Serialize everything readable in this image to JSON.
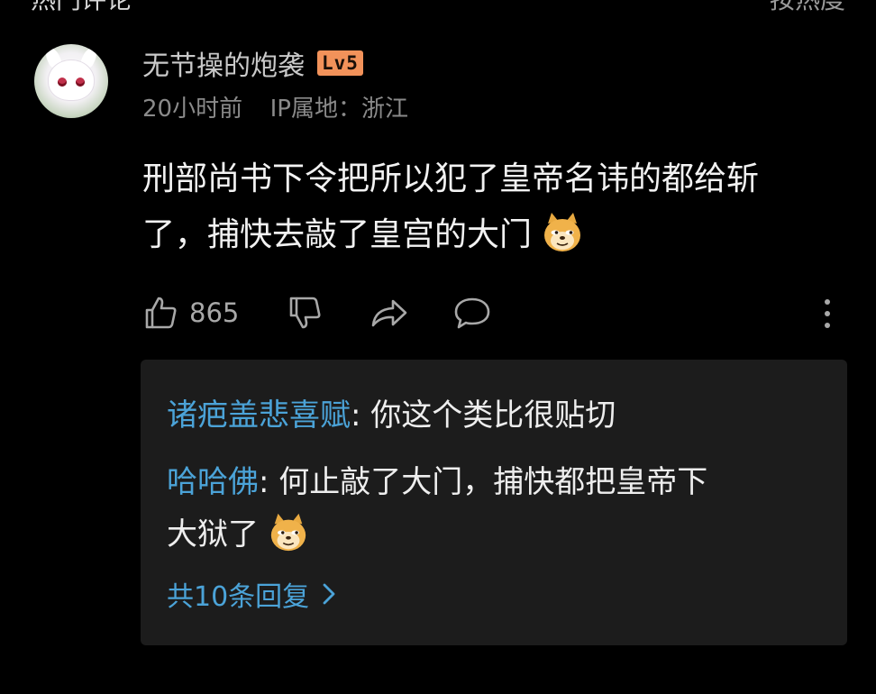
{
  "header": {
    "section_title": "热门评论",
    "sort_label": "按热度"
  },
  "comment": {
    "username": "无节操的炮袭",
    "level": "Lv5",
    "time": "20小时前",
    "ip_location": "IP属地：浙江",
    "text_line1": "刑部尚书下令把所以犯了皇帝名讳的都给斩",
    "text_line2": "了，捕快去敲了皇宫的大门",
    "emoji": "doge-emoji",
    "like_count": "865",
    "icons": [
      "thumbs-up-icon",
      "thumbs-down-icon",
      "share-icon",
      "comment-icon",
      "more-icon"
    ]
  },
  "replies": {
    "items": [
      {
        "name": "诸疤盖悲喜赋",
        "separator": ":",
        "text": "你这个类比很贴切"
      },
      {
        "name": "哈哈佛",
        "separator": ":",
        "text_line1": "何止敲了大门，捕快都把皇帝下",
        "text_line2": "大狱了"
      }
    ],
    "more_label": "共10条回复"
  },
  "colors": {
    "background": "#000000",
    "reply_box": "#1c1c1c",
    "link_blue": "#4ba3d8",
    "level_badge": "#f2925a"
  }
}
